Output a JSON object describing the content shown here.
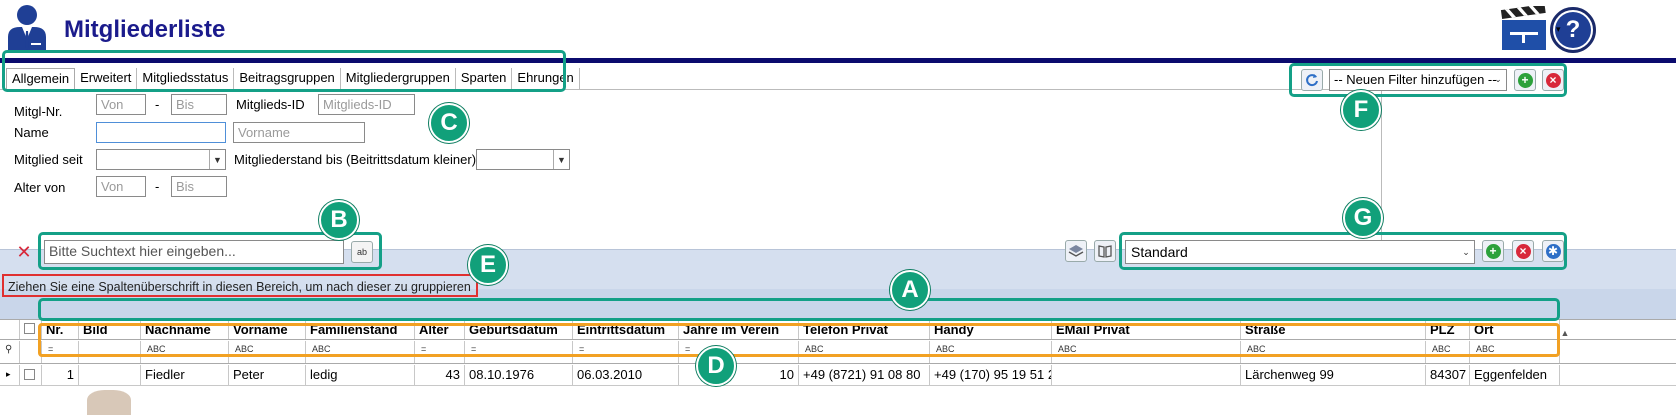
{
  "header": {
    "title": "Mitgliederliste",
    "help_label": "?"
  },
  "tabs": [
    {
      "label": "Allgemein",
      "active": true
    },
    {
      "label": "Erweitert"
    },
    {
      "label": "Mitgliedsstatus"
    },
    {
      "label": "Beitragsgruppen"
    },
    {
      "label": "Mitgliedergruppen"
    },
    {
      "label": "Sparten"
    },
    {
      "label": "Ehrungen"
    }
  ],
  "filters": {
    "mitgl_nr_label": "Mitgl-Nr.",
    "von_placeholder": "Von",
    "dash": "-",
    "bis_placeholder": "Bis",
    "mitglieds_id_label": "Mitglieds-ID",
    "mitglieds_id_placeholder": "Mitglieds-ID",
    "name_label": "Name",
    "vorname_placeholder": "Vorname",
    "mitglied_seit_label": "Mitglied seit",
    "mitgliederstand_label": "Mitgliederstand bis (Beitrittsdatum kleiner)",
    "alter_von_label": "Alter von"
  },
  "filter_bar": {
    "select_value": "-- Neuen Filter hinzufügen --"
  },
  "toolbar": {
    "search_placeholder": "Bitte Suchtext hier eingeben...",
    "search_btn_text": "ab",
    "layout_value": "Standard"
  },
  "group_panel": {
    "text": "Ziehen Sie eine Spaltenüberschrift in diesen Bereich, um nach dieser zu gruppieren"
  },
  "grid": {
    "columns": [
      "Nr.",
      "Bild",
      "Nachname",
      "Vorname",
      "Familienstand",
      "Alter",
      "Geburtsdatum",
      "Eintrittsdatum",
      "Jahre im Verein",
      "Telefon Privat",
      "Handy",
      "EMail Privat",
      "Straße",
      "PLZ",
      "Ort"
    ],
    "filter_eq": "=",
    "filter_abc": "ABC",
    "rows": [
      {
        "nr": "1",
        "bild": "",
        "nachname": "Fiedler",
        "vorname": "Peter",
        "familienstand": "ledig",
        "alter": "43",
        "geburtsdatum": "08.10.1976",
        "eintrittsdatum": "06.03.2010",
        "jahre": "10",
        "telefon": "+49 (8721) 91 08 80",
        "handy": "+49 (170) 95 19 51 2",
        "email": "",
        "strasse": "Lärchenweg 99",
        "plz": "84307",
        "ort": "Eggenfelden"
      }
    ]
  },
  "annotations": {
    "A": "A",
    "B": "B",
    "C": "C",
    "D": "D",
    "E": "E",
    "F": "F",
    "G": "G"
  },
  "colors": {
    "title": "#1b1b8c",
    "header_line": "#0b0b6e",
    "toolbar_bg": "#d5dfef",
    "annotation_teal": "#14a087",
    "annotation_orange": "#f2a123",
    "annotation_red": "#e03030"
  }
}
